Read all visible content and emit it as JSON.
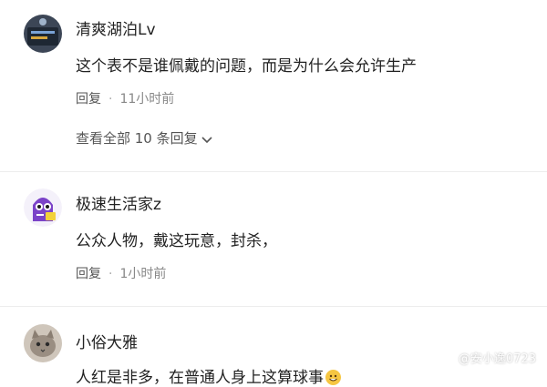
{
  "comments": [
    {
      "username": "清爽湖泊Lv",
      "content": "这个表不是谁佩戴的问题，而是为什么会允许生产",
      "reply_label": "回复",
      "time": "11小时前",
      "view_all": "查看全部 10 条回复"
    },
    {
      "username": "极速生活家z",
      "content": "公众人物，戴这玩意，封杀，",
      "reply_label": "回复",
      "time": "1小时前"
    },
    {
      "username": "小俗大雅",
      "content": "人红是非多，在普通人身上这算球事"
    }
  ],
  "separator": "·",
  "watermark": "@安小逸0723",
  "colors": {
    "text": "#222222",
    "meta": "#888888",
    "divider": "#ededed"
  },
  "icons": [
    "chevron-down-icon",
    "grinning-emoji-icon",
    "phone-chat-avatar",
    "purple-monster-avatar",
    "cat-avatar"
  ]
}
